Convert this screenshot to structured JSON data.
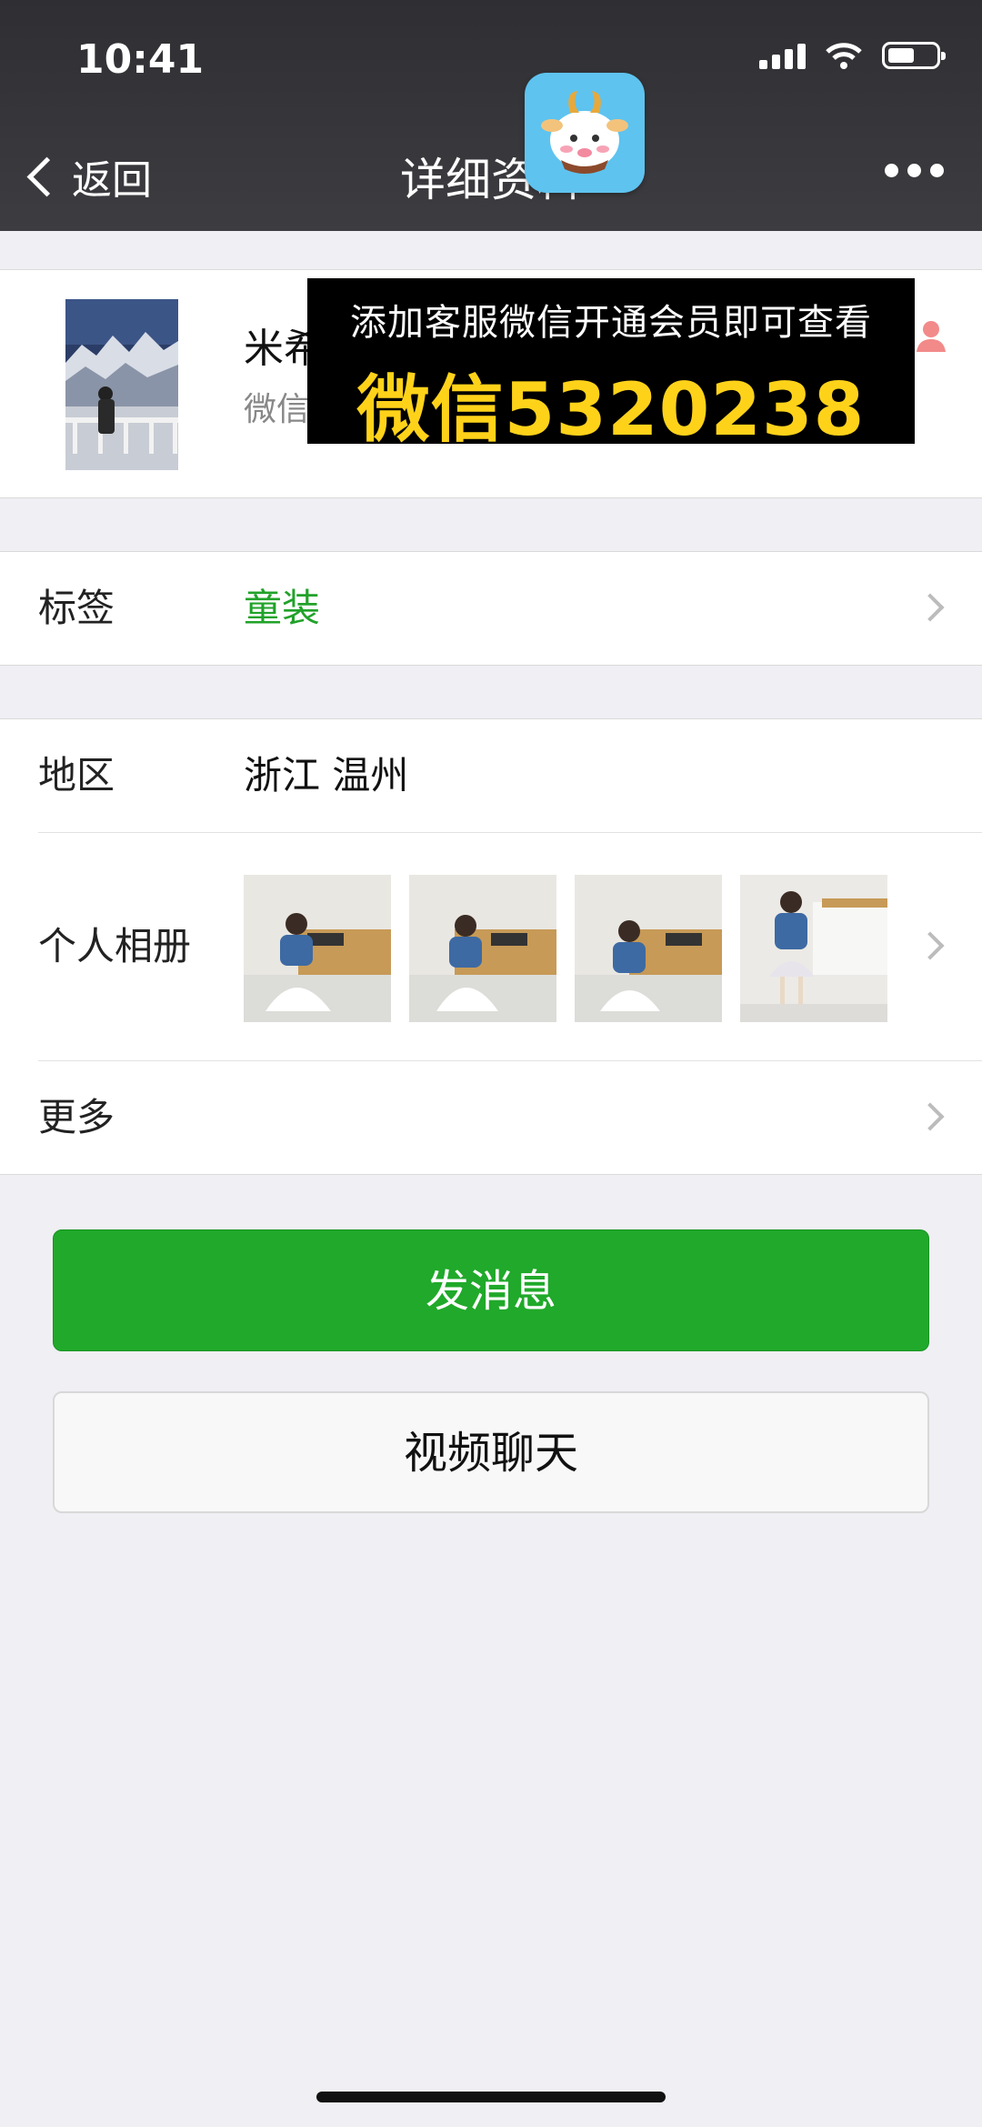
{
  "status_bar": {
    "time": "10:41"
  },
  "nav": {
    "back_label": "返回",
    "title": "详细资料"
  },
  "profile": {
    "name": "米希",
    "wechat_id_prefix": "微信"
  },
  "overlay_ad": {
    "line1": "添加客服微信开通会员即可查看",
    "line2": "微信5320238"
  },
  "tag_row": {
    "label": "标签",
    "value": "童装",
    "value_color": "#21a22a"
  },
  "region_row": {
    "label": "地区",
    "value": "浙江 温州"
  },
  "album_row": {
    "label": "个人相册"
  },
  "more_row": {
    "label": "更多"
  },
  "buttons": {
    "send_message": "发消息",
    "video_chat": "视频聊天"
  },
  "colors": {
    "primary_green": "#20a92a",
    "nav_bg": "#333337",
    "page_bg": "#efeff4"
  }
}
